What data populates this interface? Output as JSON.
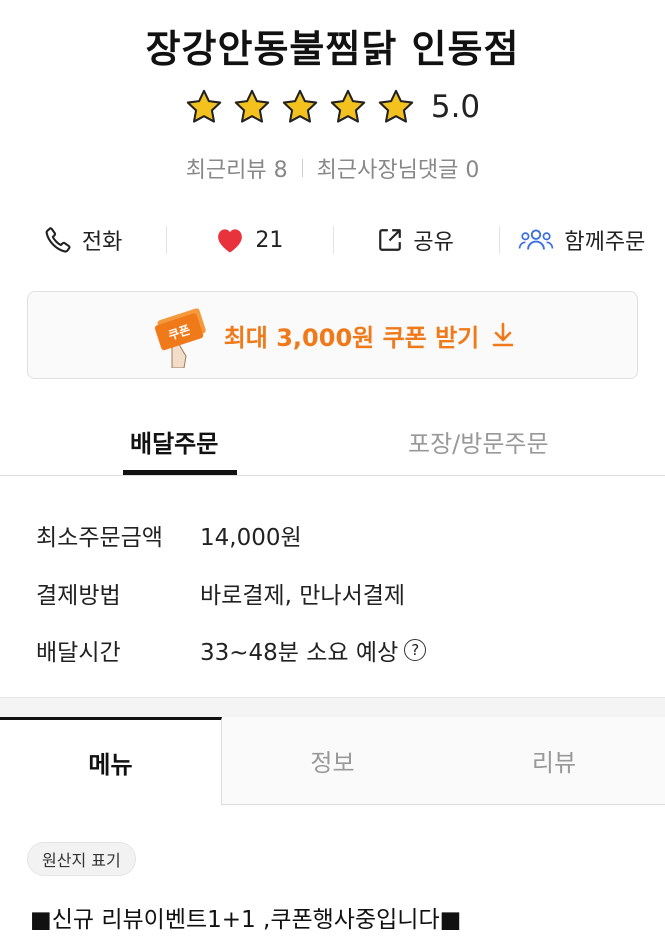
{
  "store": {
    "name": "장강안동불찜닭 인동점",
    "rating": "5.0",
    "stars": 5,
    "recent_reviews": "최근리뷰 8",
    "owner_replies": "최근사장님댓글 0"
  },
  "actions": {
    "call_label": "전화",
    "like_count": "21",
    "share_label": "공유",
    "group_order_label": "함께주문"
  },
  "coupon": {
    "label": "최대 3,000원 쿠폰 받기",
    "badge_text": "쿠폰"
  },
  "order_tabs": {
    "delivery": "배달주문",
    "pickup": "포장/방문주문"
  },
  "order_info": [
    {
      "label": "최소주문금액",
      "value": "14,000원"
    },
    {
      "label": "결제방법",
      "value": "바로결제, 만나서결제"
    },
    {
      "label": "배달시간",
      "value": "33~48분 소요 예상"
    }
  ],
  "content_tabs": {
    "menu": "메뉴",
    "info": "정보",
    "review": "리뷰"
  },
  "origin_label": "원산지 표기",
  "notice": "■신규 리뷰이벤트1+1 ,쿠폰행사중입니다■",
  "colors": {
    "accent": "#f07a1a",
    "star": "#f4c21f",
    "heart": "#e8323c",
    "group_icon": "#3b6fe0"
  }
}
